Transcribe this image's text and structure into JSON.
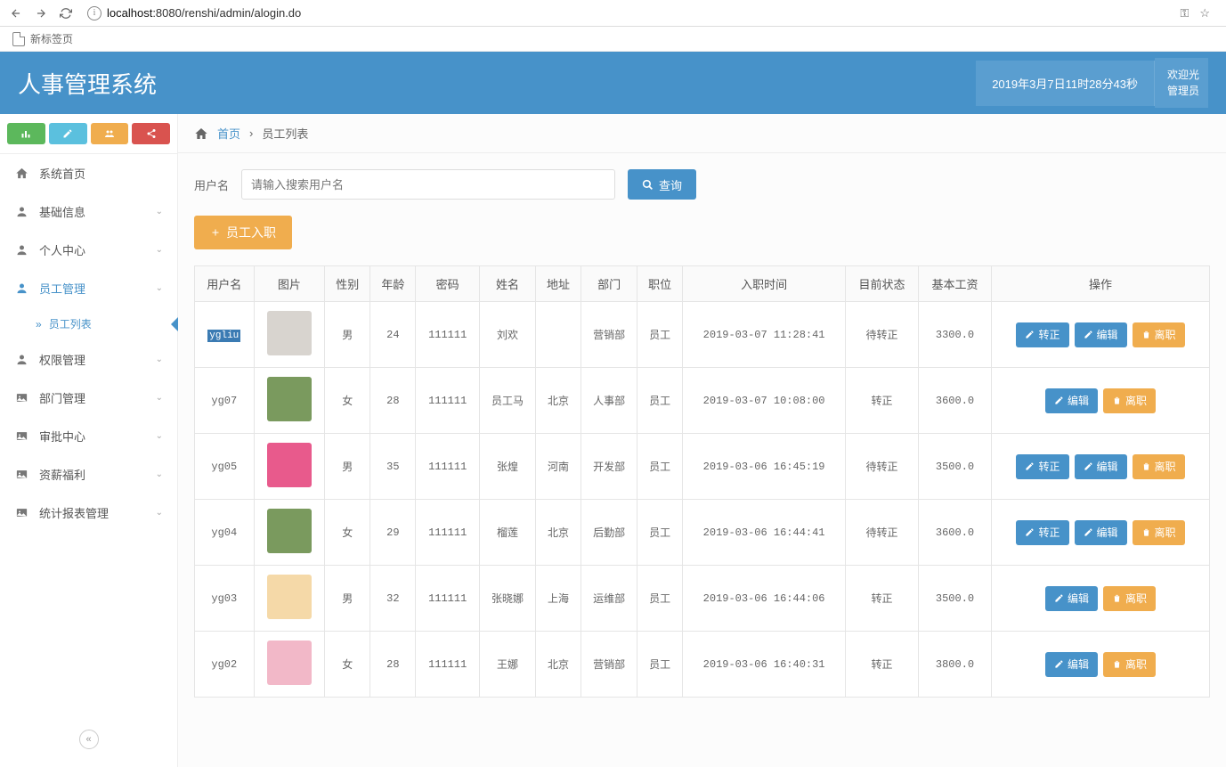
{
  "browser": {
    "url_prefix": "localhost",
    "url_port_path": ":8080/renshi/admin/alogin.do",
    "bookmark_new_tab": "新标签页"
  },
  "header": {
    "title": "人事管理系统",
    "datetime": "2019年3月7日11时28分43秒",
    "welcome_line1": "欢迎光",
    "welcome_line2": "管理员"
  },
  "sidebar": {
    "items": [
      {
        "icon": "home",
        "label": "系统首页",
        "collapsible": false
      },
      {
        "icon": "user",
        "label": "基础信息",
        "collapsible": true
      },
      {
        "icon": "user",
        "label": "个人中心",
        "collapsible": true
      },
      {
        "icon": "user",
        "label": "员工管理",
        "collapsible": true,
        "active": true
      },
      {
        "icon": "user",
        "label": "权限管理",
        "collapsible": true
      },
      {
        "icon": "image",
        "label": "部门管理",
        "collapsible": true
      },
      {
        "icon": "image",
        "label": "审批中心",
        "collapsible": true
      },
      {
        "icon": "image",
        "label": "资薪福利",
        "collapsible": true
      },
      {
        "icon": "image",
        "label": "统计报表管理",
        "collapsible": true
      }
    ],
    "sublink": "员工列表"
  },
  "breadcrumb": {
    "home": "首页",
    "current": "员工列表"
  },
  "search": {
    "label": "用户名",
    "placeholder": "请输入搜索用户名",
    "button": "查询"
  },
  "add_button": "员工入职",
  "table": {
    "headers": [
      "用户名",
      "图片",
      "性别",
      "年龄",
      "密码",
      "姓名",
      "地址",
      "部门",
      "职位",
      "入职时间",
      "目前状态",
      "基本工资",
      "操作"
    ],
    "rows": [
      {
        "username": "ygliu",
        "selected": true,
        "avatar_bg": "#d8d4cf",
        "gender": "男",
        "age": "24",
        "password": "111111",
        "name": "刘欢",
        "addr": "",
        "dept": "营销部",
        "pos": "员工",
        "hire": "2019-03-07 11:28:41",
        "status": "待转正",
        "salary": "3300.0",
        "ops": [
          "转正",
          "编辑",
          "离职"
        ]
      },
      {
        "username": "yg07",
        "avatar_bg": "#7a9a5e",
        "gender": "女",
        "age": "28",
        "password": "111111",
        "name": "员工马",
        "addr": "北京",
        "dept": "人事部",
        "pos": "员工",
        "hire": "2019-03-07 10:08:00",
        "status": "转正",
        "salary": "3600.0",
        "ops": [
          "编辑",
          "离职"
        ]
      },
      {
        "username": "yg05",
        "avatar_bg": "#e85a8c",
        "gender": "男",
        "age": "35",
        "password": "111111",
        "name": "张煌",
        "addr": "河南",
        "dept": "开发部",
        "pos": "员工",
        "hire": "2019-03-06 16:45:19",
        "status": "待转正",
        "salary": "3500.0",
        "ops": [
          "转正",
          "编辑",
          "离职"
        ]
      },
      {
        "username": "yg04",
        "avatar_bg": "#7a9a5e",
        "gender": "女",
        "age": "29",
        "password": "111111",
        "name": "榴莲",
        "addr": "北京",
        "dept": "后勤部",
        "pos": "员工",
        "hire": "2019-03-06 16:44:41",
        "status": "待转正",
        "salary": "3600.0",
        "ops": [
          "转正",
          "编辑",
          "离职"
        ]
      },
      {
        "username": "yg03",
        "avatar_bg": "#f5d9a8",
        "gender": "男",
        "age": "32",
        "password": "111111",
        "name": "张晓娜",
        "addr": "上海",
        "dept": "运维部",
        "pos": "员工",
        "hire": "2019-03-06 16:44:06",
        "status": "转正",
        "salary": "3500.0",
        "ops": [
          "编辑",
          "离职"
        ]
      },
      {
        "username": "yg02",
        "avatar_bg": "#f2b8c8",
        "gender": "女",
        "age": "28",
        "password": "111111",
        "name": "王娜",
        "addr": "北京",
        "dept": "营销部",
        "pos": "员工",
        "hire": "2019-03-06 16:40:31",
        "status": "转正",
        "salary": "3800.0",
        "ops": [
          "编辑",
          "离职"
        ]
      }
    ]
  },
  "op_labels": {
    "转正": "转正",
    "编辑": "编辑",
    "离职": "离职"
  }
}
